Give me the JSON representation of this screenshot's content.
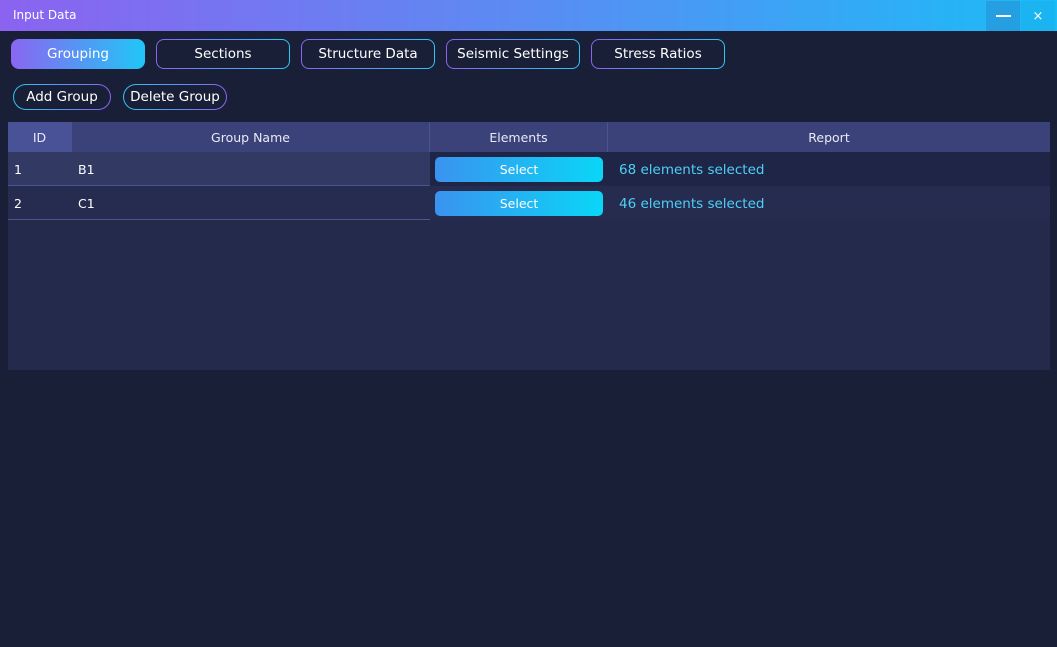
{
  "window": {
    "title": "Input Data",
    "close_glyph": "×"
  },
  "tabs": [
    {
      "label": "Grouping",
      "active": true
    },
    {
      "label": "Sections",
      "active": false
    },
    {
      "label": "Structure Data",
      "active": false
    },
    {
      "label": "Seismic Settings",
      "active": false
    },
    {
      "label": "Stress Ratios",
      "active": false
    }
  ],
  "actions": {
    "add_label": "Add Group",
    "delete_label": "Delete Group"
  },
  "table": {
    "columns": [
      "ID",
      "Group Name",
      "Elements",
      "Report"
    ],
    "rows": [
      {
        "id": "1",
        "name": "B1",
        "button": "Select",
        "report": "68 elements selected"
      },
      {
        "id": "2",
        "name": "C1",
        "button": "Select",
        "report": "46 elements selected"
      }
    ]
  },
  "colors": {
    "accent_start": "#8b63f0",
    "accent_end": "#1bbcf7",
    "background": "#1a1f38",
    "report_text": "#4ed0f5"
  },
  "icons": {
    "minimize": "minimize-icon",
    "close": "close-icon"
  }
}
